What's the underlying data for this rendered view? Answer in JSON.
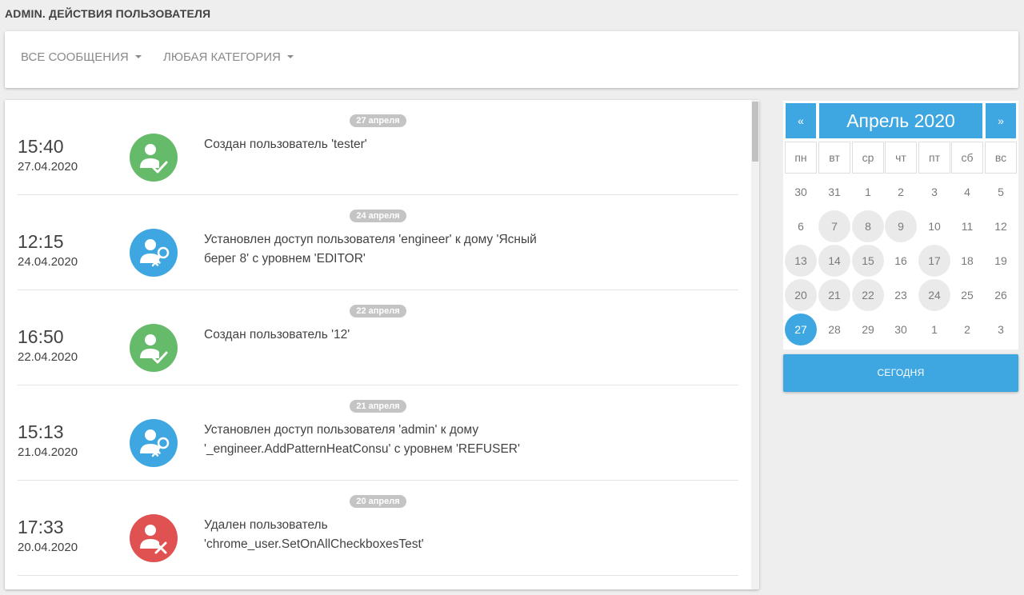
{
  "page": {
    "title": "ADMIN. ДЕЙСТВИЯ ПОЛЬЗОВАТЕЛЯ"
  },
  "filters": {
    "messages_label": "ВСЕ СООБЩЕНИЯ",
    "category_label": "ЛЮБАЯ КАТЕГОРИЯ"
  },
  "colors": {
    "accent": "#3ea7e1",
    "created": "#66bb6a",
    "access": "#3ea7e1",
    "deleted": "#e05252"
  },
  "events": [
    {
      "chip": "27 апреля",
      "time": "15:40",
      "date": "27.04.2020",
      "icon": "user-check-icon",
      "kind": "created",
      "lines": [
        "Создан пользователь 'tester'"
      ]
    },
    {
      "chip": "24 апреля",
      "time": "12:15",
      "date": "24.04.2020",
      "icon": "user-key-icon",
      "kind": "access",
      "lines": [
        "Установлен доступ пользователя 'engineer' к дому 'Ясный",
        "берег 8' с уровнем 'EDITOR'"
      ]
    },
    {
      "chip": "22 апреля",
      "time": "16:50",
      "date": "22.04.2020",
      "icon": "user-check-icon",
      "kind": "created",
      "lines": [
        "Создан пользователь '12'"
      ]
    },
    {
      "chip": "21 апреля",
      "time": "15:13",
      "date": "21.04.2020",
      "icon": "user-key-icon",
      "kind": "access",
      "lines": [
        "Установлен доступ пользователя 'admin' к дому",
        "'_engineer.AddPatternHeatConsu' с уровнем 'REFUSER'"
      ]
    },
    {
      "chip": "20 апреля",
      "time": "17:33",
      "date": "20.04.2020",
      "icon": "user-remove-icon",
      "kind": "deleted",
      "lines": [
        "Удален пользователь",
        "'chrome_user.SetOnAllCheckboxesTest'"
      ]
    }
  ],
  "calendar": {
    "title": "Апрель 2020",
    "prev_label": "«",
    "next_label": "»",
    "weekdays": [
      "пн",
      "вт",
      "ср",
      "чт",
      "пт",
      "сб",
      "вс"
    ],
    "weeks": [
      [
        "30",
        "31",
        "1",
        "2",
        "3",
        "4",
        "5"
      ],
      [
        "6",
        "7",
        "8",
        "9",
        "10",
        "11",
        "12"
      ],
      [
        "13",
        "14",
        "15",
        "16",
        "17",
        "18",
        "19"
      ],
      [
        "20",
        "21",
        "22",
        "23",
        "24",
        "25",
        "26"
      ],
      [
        "27",
        "28",
        "29",
        "30",
        "1",
        "2",
        "3"
      ]
    ],
    "days_with_events": [
      "7",
      "8",
      "9",
      "13",
      "14",
      "15",
      "17",
      "20",
      "21",
      "22",
      "24"
    ],
    "selected_day": "27",
    "today_label": "СЕГОДНЯ"
  }
}
